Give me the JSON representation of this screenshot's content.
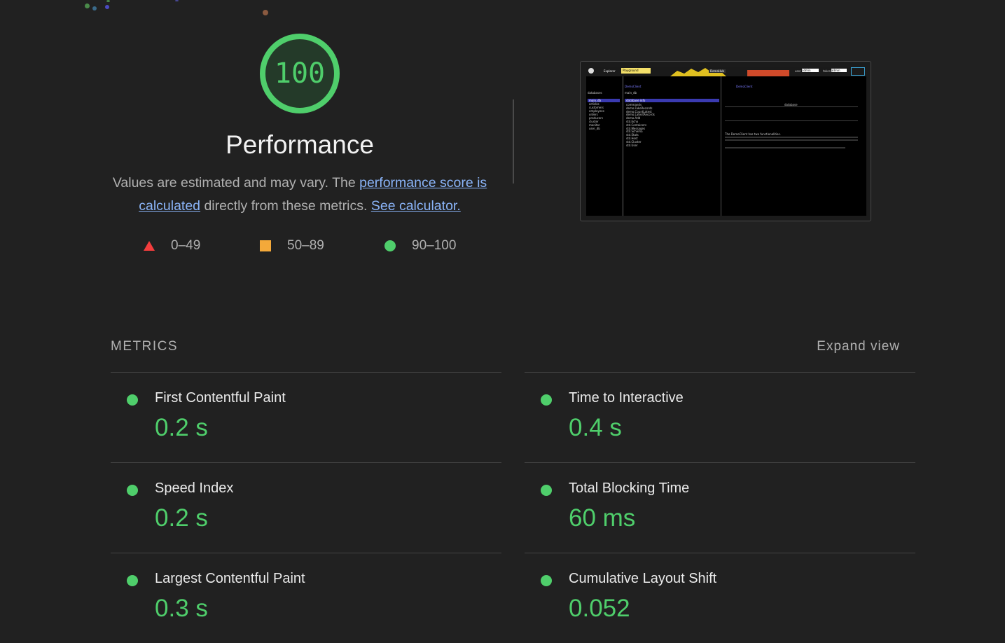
{
  "gauge": {
    "score": "100",
    "title": "Performance"
  },
  "description": {
    "prefix": "Values are estimated and may vary. The ",
    "link1": "performance score is calculated",
    "middle": " directly from these metrics. ",
    "link2": "See calculator."
  },
  "legend": [
    {
      "range": "0–49",
      "shape": "triangle",
      "color": "#f33d3d"
    },
    {
      "range": "50–89",
      "shape": "square",
      "color": "#f4a93a"
    },
    {
      "range": "90–100",
      "shape": "circle",
      "color": "#4fce6b"
    }
  ],
  "thumbnail": {
    "tabs": [
      "Explorer",
      "Playground"
    ],
    "hub": "DemoHub",
    "user_label": "user",
    "user_value": "admin",
    "token_label": "token",
    "token_value": "admin",
    "left_header": "databases",
    "db_list": [
      "main_db",
      "articles",
      "customers",
      "employees",
      "orders",
      "producers",
      "cluster",
      "monitor",
      "user_db"
    ],
    "client": "DemoClient",
    "db_name": "main_db",
    "section": "database info",
    "commands": [
      "commands",
      "demo.FakeRecords",
      "demo.CountLatest",
      "demo.LatestRecords",
      "demo.Add",
      "std.Echo",
      "std.Containers",
      "std.Messages",
      "std.Schema",
      "std.Stats",
      "std.Host",
      "std.Cluster",
      "std.User"
    ],
    "right_client": "DemoClient",
    "right_title": "database",
    "right_text": "The DemoClient has two functionalities."
  },
  "metrics_header": "METRICS",
  "expand_label": "Expand view",
  "metrics": [
    {
      "label": "First Contentful Paint",
      "value": "0.2 s"
    },
    {
      "label": "Time to Interactive",
      "value": "0.4 s"
    },
    {
      "label": "Speed Index",
      "value": "0.2 s"
    },
    {
      "label": "Total Blocking Time",
      "value": "60 ms"
    },
    {
      "label": "Largest Contentful Paint",
      "value": "0.3 s"
    },
    {
      "label": "Cumulative Layout Shift",
      "value": "0.052"
    }
  ],
  "colors": {
    "pass": "#4fce6b",
    "link": "#8ab4f8",
    "background": "#212121"
  }
}
